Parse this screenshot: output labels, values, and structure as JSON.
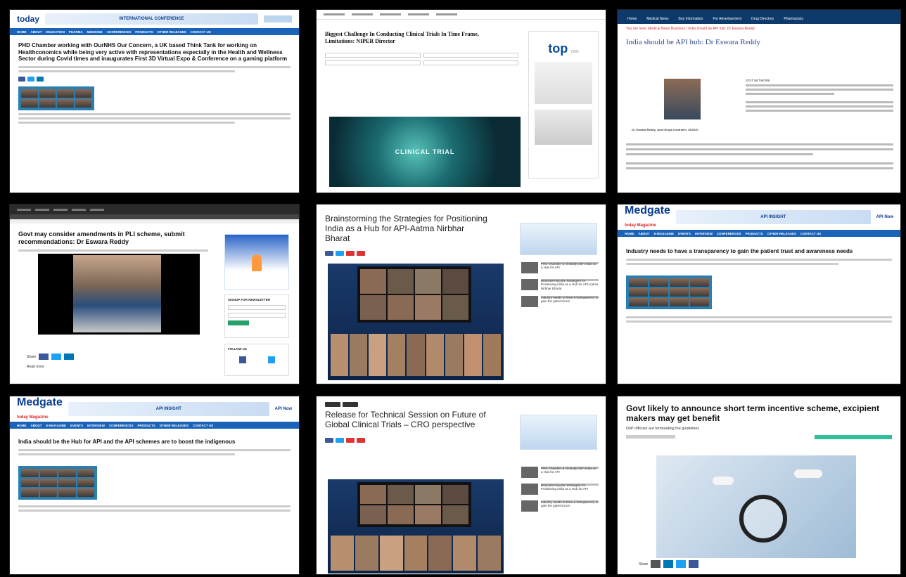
{
  "tiles": [
    {
      "id": 1,
      "site": "today",
      "banner": "INTERNATIONAL CONFERENCE",
      "nav": [
        "HOME",
        "ABOUT",
        "EDUCATION",
        "PHARMA",
        "MEDICINE",
        "CONFERENCES",
        "PRODUCTS",
        "OTHER RELEASES",
        "CONTACT US"
      ],
      "headline": "PHD Chamber working with OurNHS Our Concern, a UK based Think Tank for working on Healthconomics while being very active with representations especially in the Health and Wellness Sector during Covid times and inaugurates First 3D Virtual Expo & Conference on a gaming platform"
    },
    {
      "id": 2,
      "headline": "Biggest Challenge In Conducting Clinical Trials In Time Frame, Limitations: NIPER Director",
      "image_label": "CLINICAL TRIAL",
      "side_logo": "top",
      "side_logo_sub": "CRO"
    },
    {
      "id": 3,
      "nav": [
        "Home",
        "Medical News",
        "Buy Information",
        "For Advertisement",
        "Drug Directory",
        "Pharmacists"
      ],
      "breadcrumb": "You are here: Medical News Business / India should be API hub: Dr Eswara Reddy",
      "headline": "India should be API hub: Dr Eswara Reddy",
      "byline": "STAT NETWORK",
      "caption": "Dr. Eswara Reddy, Joint Drugs Controller, CDSCO"
    },
    {
      "id": 4,
      "headline": "Govt may consider amendments in PLI scheme, submit recommendations: Dr Eswara Reddy",
      "sidebar_heading": "SIGNUP FOR NEWSLETTER",
      "follow_heading": "FOLLOW US",
      "share_label": "Share",
      "comment_label": "Read more"
    },
    {
      "id": 5,
      "headline": "Brainstorming the Strategies for Positioning India as a Hub for API-Aatma Nirbhar Bharat",
      "side_items": [
        "PHD Chamber & Globally pitch India as a Hub for API",
        "Brainstorming the Strategies for Positioning India as a Hub for API-Aatma Nirbhar Bharat",
        "Industry needs to have a transparency to gain the patient trust"
      ]
    },
    {
      "id": 6,
      "site": "Medgate",
      "site_sub": "today Magazine",
      "banner": "API INSIGHT",
      "banner_right": "API Now",
      "nav": [
        "HOME",
        "ABOUT",
        "E-MAGAZINE",
        "EVENTS",
        "INTERVIEW",
        "CONFERENCES",
        "PRODUCTS",
        "OTHER RELEASES",
        "CONTACT US"
      ],
      "headline": "Industry needs to have a transparency to gain the patient trust and awareness needs"
    },
    {
      "id": 7,
      "site": "Medgate",
      "site_sub": "today Magazine",
      "banner": "API INSIGHT",
      "banner_right": "API Now",
      "nav": [
        "HOME",
        "ABOUT",
        "E-MAGAZINE",
        "EVENTS",
        "INTERVIEW",
        "CONFERENCES",
        "PRODUCTS",
        "OTHER RELEASES",
        "CONTACT US"
      ],
      "headline": "India should be the Hub for API and the API schemes are to boost the indigenous"
    },
    {
      "id": 8,
      "headline": "Release for Technical Session on Future of Global Clinical Trials – CRO perspective",
      "side_items": [
        "PHD Chamber & Globally pitch India as a Hub for API",
        "Brainstorming the Strategies for Positioning India as a Hub for API",
        "Industry needs to have a transparency to gain the patient trust"
      ]
    },
    {
      "id": 9,
      "headline": "Govt likely to announce short term incentive scheme, excipient makers may get benefit",
      "subheading": "DoP officials are formulating the guidelines",
      "share_label": "Share"
    }
  ]
}
